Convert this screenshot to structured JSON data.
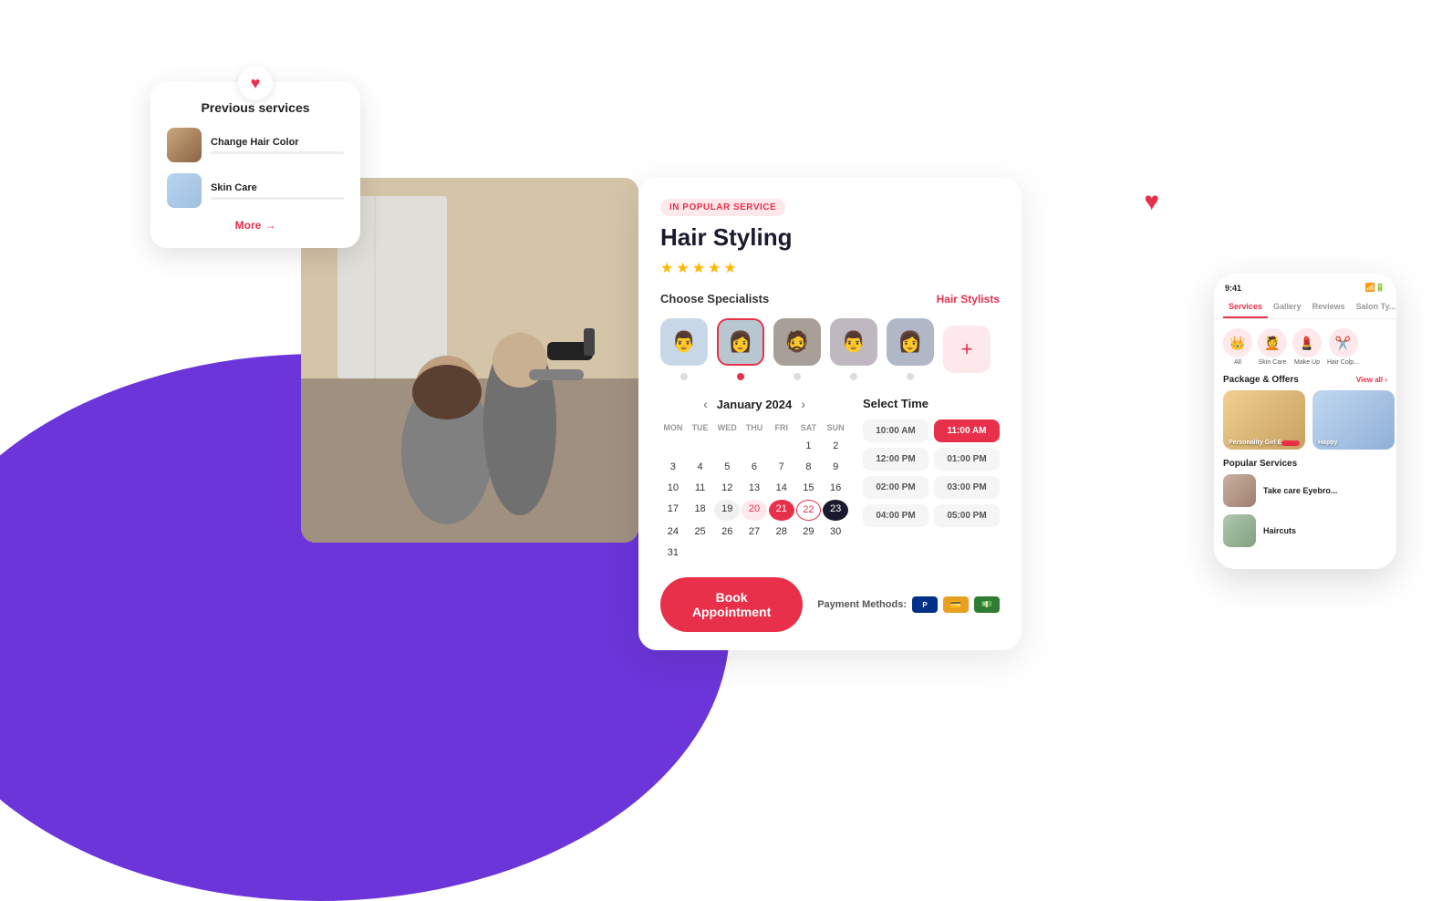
{
  "background": {
    "arc_color": "#6B35D9"
  },
  "prev_services_card": {
    "heart_icon": "♥",
    "title": "Previous services",
    "services": [
      {
        "name": "Change Hair Color",
        "thumb_type": "hair"
      },
      {
        "name": "Skin Care",
        "thumb_type": "skin"
      }
    ],
    "more_label": "More",
    "more_arrow": "→"
  },
  "booking_panel": {
    "badge": "IN POPULAR SERVICE",
    "title": "Hair Styling",
    "stars": [
      "★",
      "★",
      "★",
      "★",
      "★"
    ],
    "specialists_label": "Choose Specialists",
    "hair_stylists_link": "Hair Stylists",
    "specialists": [
      {
        "id": 1,
        "type": "avatar-1",
        "selected": false
      },
      {
        "id": 2,
        "type": "avatar-2",
        "selected": true
      },
      {
        "id": 3,
        "type": "avatar-3",
        "selected": false
      },
      {
        "id": 4,
        "type": "avatar-4",
        "selected": false
      },
      {
        "id": 5,
        "type": "avatar-5",
        "selected": false
      }
    ],
    "calendar": {
      "month": "January 2024",
      "prev_arrow": "‹",
      "next_arrow": "›",
      "day_headers": [
        "MON",
        "TUE",
        "WED",
        "THU",
        "FRI",
        "SAT",
        "SUN"
      ],
      "weeks": [
        [
          "",
          "",
          "",
          "",
          "",
          "1",
          "2",
          "3"
        ],
        [
          "4",
          "5",
          "6",
          "7",
          "8",
          "9",
          "10"
        ],
        [
          "11",
          "12",
          "13",
          "14",
          "15",
          "16",
          "17"
        ],
        [
          "18",
          "19",
          "20",
          "21",
          "22",
          "23",
          "24"
        ],
        [
          "25",
          "26",
          "27",
          "28",
          "29",
          "30",
          "31"
        ]
      ],
      "selected_dates": {
        "19": "today",
        "20": "selected-pink",
        "21": "selected-red",
        "22": "selected-outline",
        "23": "selected-dark"
      }
    },
    "time": {
      "title": "Select Time",
      "slots": [
        {
          "label": "10:00 AM",
          "selected": false
        },
        {
          "label": "11:00 AM",
          "selected": true
        },
        {
          "label": "12:00 PM",
          "selected": false
        },
        {
          "label": "01:00 PM",
          "selected": false
        },
        {
          "label": "02:00 PM",
          "selected": false
        },
        {
          "label": "03:00 PM",
          "selected": false
        },
        {
          "label": "04:00 PM",
          "selected": false
        },
        {
          "label": "05:00 PM",
          "selected": false
        }
      ]
    },
    "book_btn_label": "Book Appointment",
    "payment_label": "Payment Methods:",
    "payment_methods": [
      "P",
      "💳",
      "💵"
    ]
  },
  "phone_mockup": {
    "status_time": "9:41",
    "tabs": [
      "Services",
      "Gallery",
      "Reviews",
      "Salon Ty..."
    ],
    "active_tab": "Services",
    "categories": [
      {
        "icon": "👑",
        "label": "All"
      },
      {
        "icon": "💆",
        "label": "Skin Care"
      },
      {
        "icon": "💄",
        "label": "Make Up"
      },
      {
        "icon": "✂️",
        "label": "Hair Colp..."
      }
    ],
    "packages_title": "Package & Offers",
    "view_all": "View all ›",
    "packages": [
      {
        "label": "Personality Girl Event",
        "type": "pkg-1"
      },
      {
        "label": "Happy",
        "type": "pkg-2"
      }
    ],
    "popular_title": "Popular Services",
    "popular_services": [
      {
        "name": "Take care Eyebro...",
        "thumb": "thumb-eyebrow"
      },
      {
        "name": "Haircuts",
        "thumb": "thumb-haircut"
      }
    ]
  },
  "heart_icon": "♥"
}
